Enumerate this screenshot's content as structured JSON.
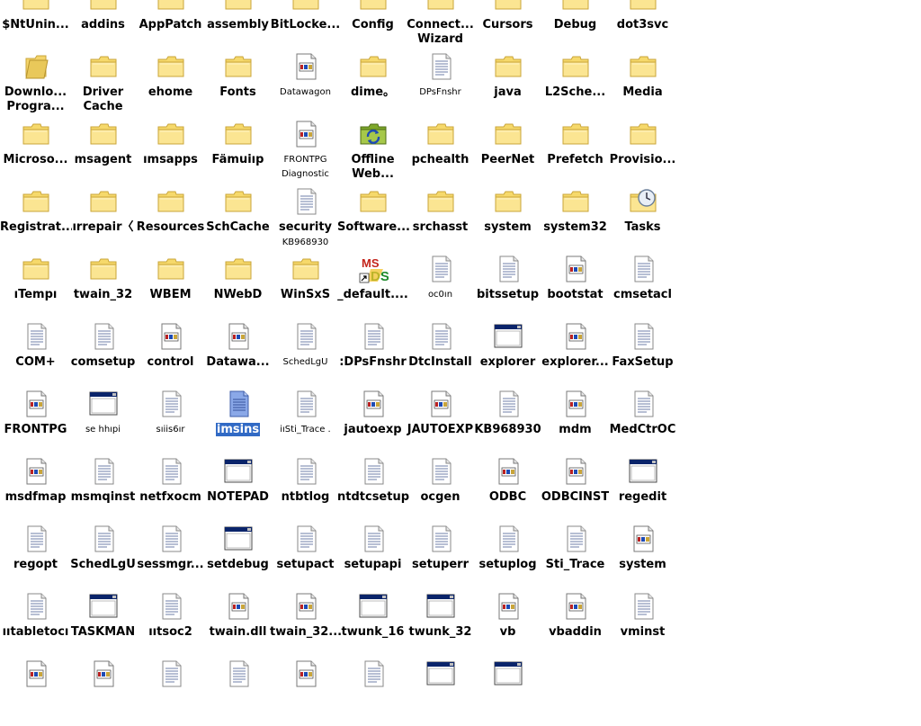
{
  "window": {
    "background": "#ffffff",
    "selection_color": "#316ac5"
  },
  "rows": [
    [
      {
        "icon": "folder-icon",
        "label": "$NtUnin..."
      },
      {
        "icon": "folder-icon",
        "label": "addins"
      },
      {
        "icon": "folder-icon",
        "label": "AppPatch"
      },
      {
        "icon": "folder-icon",
        "label": "assembly"
      },
      {
        "icon": "folder-icon",
        "label": "BitLocke..."
      },
      {
        "icon": "folder-icon",
        "label": "Config"
      },
      {
        "icon": "folder-icon",
        "label": "Connect...",
        "label2": "Wizard"
      },
      {
        "icon": "folder-icon",
        "label": "Cursors"
      },
      {
        "icon": "folder-icon",
        "label": "Debug"
      },
      {
        "icon": "folder-icon",
        "label": "dot3svc"
      }
    ],
    [
      {
        "icon": "download-folder-icon",
        "label": "Downlo...",
        "label2": "Progra..."
      },
      {
        "icon": "folder-icon",
        "label": "Driver",
        "label2": "Cache"
      },
      {
        "icon": "folder-icon",
        "label": "ehome"
      },
      {
        "icon": "folder-icon",
        "label": "Fonts"
      },
      {
        "icon": "app-file-icon",
        "label": "Datawagon",
        "small": true
      },
      {
        "icon": "folder-icon",
        "label": "dime。"
      },
      {
        "icon": "text-file-icon",
        "label": "DPsFnshr",
        "small": true
      },
      {
        "icon": "folder-icon",
        "label": "java"
      },
      {
        "icon": "folder-icon",
        "label": "L2Sche..."
      },
      {
        "icon": "folder-icon",
        "label": "Media"
      }
    ],
    [
      {
        "icon": "folder-icon",
        "label": "Microso..."
      },
      {
        "icon": "folder-icon",
        "label": "msagent"
      },
      {
        "icon": "folder-icon",
        "label": "ımsapps"
      },
      {
        "icon": "folder-icon",
        "label": "Fämuiıp"
      },
      {
        "icon": "app-file-icon",
        "label": "FRONTPG",
        "small": true,
        "label2": "Diagnostic"
      },
      {
        "icon": "offline-web-icon",
        "label": "Offline",
        "label2": "Web..."
      },
      {
        "icon": "folder-icon",
        "label": "pchealth"
      },
      {
        "icon": "folder-icon",
        "label": "PeerNet"
      },
      {
        "icon": "folder-icon",
        "label": "Prefetch"
      },
      {
        "icon": "folder-icon",
        "label": "Provisio..."
      }
    ],
    [
      {
        "icon": "folder-icon",
        "label": "Registrat..."
      },
      {
        "icon": "folder-icon",
        "label": "ırrepair〈"
      },
      {
        "icon": "folder-icon",
        "label": "Resources"
      },
      {
        "icon": "folder-icon",
        "label": "SchCache"
      },
      {
        "icon": "text-file-icon",
        "label": "security",
        "label2": "KB968930",
        "small2": true
      },
      {
        "icon": "folder-icon",
        "label": "Software..."
      },
      {
        "icon": "folder-icon",
        "label": "srchasst"
      },
      {
        "icon": "folder-icon",
        "label": "system"
      },
      {
        "icon": "folder-icon",
        "label": "system32"
      },
      {
        "icon": "tasks-folder-icon",
        "label": "Tasks"
      }
    ],
    [
      {
        "icon": "folder-icon",
        "label": "ıTempı"
      },
      {
        "icon": "folder-icon",
        "label": "twain_32"
      },
      {
        "icon": "folder-icon",
        "label": "WBEM"
      },
      {
        "icon": "folder-icon",
        "label": "NWebD"
      },
      {
        "icon": "folder-icon",
        "label": "WinSxS"
      },
      {
        "icon": "ms-shortcut-icon",
        "label": "_default...."
      },
      {
        "icon": "text-file-icon",
        "label": "oc0ın",
        "small": true
      },
      {
        "icon": "text-file-icon",
        "label": "bitssetup"
      },
      {
        "icon": "app-file-icon",
        "label": "bootstat"
      },
      {
        "icon": "text-file-icon",
        "label": "cmsetacl"
      }
    ],
    [
      {
        "icon": "text-file-icon",
        "label": "COM+"
      },
      {
        "icon": "text-file-icon",
        "label": "comsetup"
      },
      {
        "icon": "app-file-icon",
        "label": "control"
      },
      {
        "icon": "app-file-icon",
        "label": "Datawa..."
      },
      {
        "icon": "text-file-icon",
        "label": "SchedLgU",
        "small": true
      },
      {
        "icon": "text-file-icon",
        "label": ":DPsFnshr"
      },
      {
        "icon": "text-file-icon",
        "label": "DtcInstall"
      },
      {
        "icon": "window-icon",
        "label": "explorer"
      },
      {
        "icon": "app-file-icon",
        "label": "explorer..."
      },
      {
        "icon": "text-file-icon",
        "label": "FaxSetup"
      }
    ],
    [
      {
        "icon": "app-file-icon",
        "label": "FRONTPG"
      },
      {
        "icon": "window-icon",
        "label": "se hhıpi",
        "small": true
      },
      {
        "icon": "text-file-icon",
        "label": "sıiis6ır",
        "small": true
      },
      {
        "icon": "blue-file-icon",
        "label": "imsins",
        "selected": true
      },
      {
        "icon": "text-file-icon",
        "label": "iıSti_Trace .",
        "small": true
      },
      {
        "icon": "app-file-icon",
        "label": "jautoexp"
      },
      {
        "icon": "app-file-icon",
        "label": "JAUTOEXP"
      },
      {
        "icon": "text-file-icon",
        "label": "KB968930"
      },
      {
        "icon": "app-file-icon",
        "label": "mdm"
      },
      {
        "icon": "text-file-icon",
        "label": "MedCtrOC"
      }
    ],
    [
      {
        "icon": "app-file-icon",
        "label": "msdfmap"
      },
      {
        "icon": "text-file-icon",
        "label": "msmqinst"
      },
      {
        "icon": "text-file-icon",
        "label": "netfxocm"
      },
      {
        "icon": "window-icon",
        "label": "NOTEPAD"
      },
      {
        "icon": "text-file-icon",
        "label": "ntbtlog"
      },
      {
        "icon": "text-file-icon",
        "label": "ntdtcsetup"
      },
      {
        "icon": "text-file-icon",
        "label": "ocgen"
      },
      {
        "icon": "app-file-icon",
        "label": "ODBC"
      },
      {
        "icon": "app-file-icon",
        "label": "ODBCINST"
      },
      {
        "icon": "window-icon",
        "label": "regedit"
      }
    ],
    [
      {
        "icon": "text-file-icon",
        "label": "regopt"
      },
      {
        "icon": "text-file-icon",
        "label": "SchedLgU"
      },
      {
        "icon": "text-file-icon",
        "label": "sessmgr..."
      },
      {
        "icon": "window-icon",
        "label": "setdebug"
      },
      {
        "icon": "text-file-icon",
        "label": "setupact"
      },
      {
        "icon": "text-file-icon",
        "label": "setupapi"
      },
      {
        "icon": "text-file-icon",
        "label": "setuperr"
      },
      {
        "icon": "text-file-icon",
        "label": "setuplog"
      },
      {
        "icon": "text-file-icon",
        "label": "Sti_Trace"
      },
      {
        "icon": "app-file-icon",
        "label": "system"
      }
    ],
    [
      {
        "icon": "text-file-icon",
        "label": "ııtabletocı"
      },
      {
        "icon": "window-icon",
        "label": "TASKMAN"
      },
      {
        "icon": "text-file-icon",
        "label": "ııtsoc2"
      },
      {
        "icon": "app-file-icon",
        "label": "twain.dll"
      },
      {
        "icon": "app-file-icon",
        "label": "twain_32..."
      },
      {
        "icon": "window-icon",
        "label": "twunk_16"
      },
      {
        "icon": "window-icon",
        "label": "twunk_32"
      },
      {
        "icon": "app-file-icon",
        "label": "vb"
      },
      {
        "icon": "app-file-icon",
        "label": "vbaddin"
      },
      {
        "icon": "text-file-icon",
        "label": "vminst"
      }
    ],
    [
      {
        "icon": "app-file-icon",
        "label": ""
      },
      {
        "icon": "app-file-icon",
        "label": ""
      },
      {
        "icon": "text-file-icon",
        "label": ""
      },
      {
        "icon": "text-file-icon",
        "label": ""
      },
      {
        "icon": "app-file-icon",
        "label": ""
      },
      {
        "icon": "text-file-icon",
        "label": ""
      },
      {
        "icon": "window-icon",
        "label": ""
      },
      {
        "icon": "window-icon",
        "label": ""
      }
    ]
  ]
}
